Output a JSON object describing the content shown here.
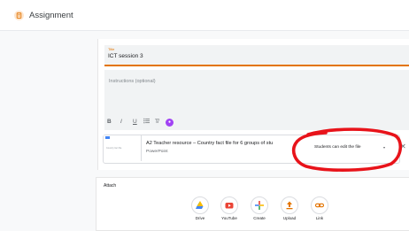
{
  "header": {
    "title": "Assignment",
    "icon": "assignment-icon"
  },
  "form": {
    "title_label": "Title",
    "title_value": "ICT session 3",
    "instructions_placeholder": "Instructions (optional)"
  },
  "toolbar": {
    "bold": "B",
    "italic": "I",
    "underline": "U",
    "clear": "T̸"
  },
  "attachment": {
    "thumbnail_text": "Country fact file",
    "title": "A2 Teacher resource – Country fact file for 6 groups of stu",
    "type": "PowerPoint",
    "permission": "Students can edit the file",
    "caret": "▾",
    "remove": "✕"
  },
  "attach_section": {
    "heading": "Attach",
    "buttons": [
      {
        "label": "Drive",
        "icon": "drive-icon"
      },
      {
        "label": "YouTube",
        "icon": "youtube-icon"
      },
      {
        "label": "Create",
        "icon": "plus-icon"
      },
      {
        "label": "Upload",
        "icon": "upload-icon"
      },
      {
        "label": "Link",
        "icon": "link-icon"
      }
    ]
  },
  "colors": {
    "accent": "#e37400",
    "annotation": "#e8131a"
  }
}
